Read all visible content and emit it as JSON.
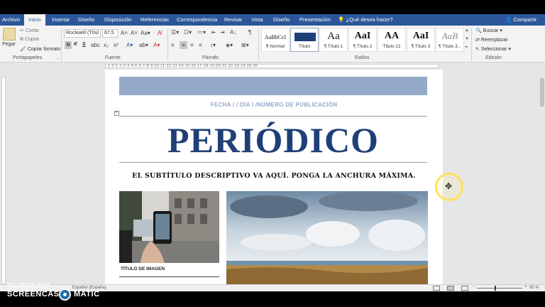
{
  "ribbon_tabs": [
    "Archivo",
    "Inicio",
    "Insertar",
    "Diseño",
    "Disposición",
    "Referencias",
    "Correspondencia",
    "Revisar",
    "Vista",
    "Diseño",
    "Presentación"
  ],
  "active_tab": "Inicio",
  "tell_me": "¿Qué desea hacer?",
  "share": "Compartir",
  "clipboard": {
    "paste": "Pegar",
    "cut": "Cortar",
    "copy": "Copiar",
    "format_painter": "Copiar formato",
    "group": "Portapapeles"
  },
  "font": {
    "name": "Rockwell (Títul",
    "size": "87,5",
    "bold": "N",
    "italic": "K",
    "underline": "S",
    "group": "Fuente"
  },
  "paragraph": {
    "group": "Párrafo"
  },
  "styles": {
    "group": "Estilos",
    "items": [
      {
        "preview": "AaBbCcI",
        "name": "¶ Normal"
      },
      {
        "preview": "",
        "name": "Título"
      },
      {
        "preview": "Aa",
        "name": "¶ Título 1"
      },
      {
        "preview": "AaI",
        "name": "¶ Título 2"
      },
      {
        "preview": "AA",
        "name": "Título 21"
      },
      {
        "preview": "AaI",
        "name": "¶ Título 3"
      },
      {
        "preview": "AaB",
        "name": "¶ Título 3..."
      }
    ]
  },
  "editing": {
    "find": "Buscar",
    "replace": "Reemplazar",
    "select": "Seleccionar",
    "group": "Edición"
  },
  "document": {
    "dateline": "FECHA / / DÍA / /NÚMERO DE PUBLICACIÓN",
    "masthead": "PERIÓDICO",
    "subtitle": "EL SUBTÍTULO DESCRIPTIVO VA AQUÍ. PONGA  LA ANCHURA MÁXIMA.",
    "caption": "TÍTULO DE IMAGEN"
  },
  "status": {
    "language": "Español (España)",
    "zoom": "80 %"
  },
  "watermark": {
    "recorded": "RECORDED WITH",
    "brand1": "SCREENCAST",
    "brand2": "MATIC"
  },
  "colors": {
    "ribbon_blue": "#2b579a",
    "masthead_blue": "#1f3f77",
    "accent_slate": "#95a9c9",
    "cursor_ring": "#ffe15a"
  }
}
